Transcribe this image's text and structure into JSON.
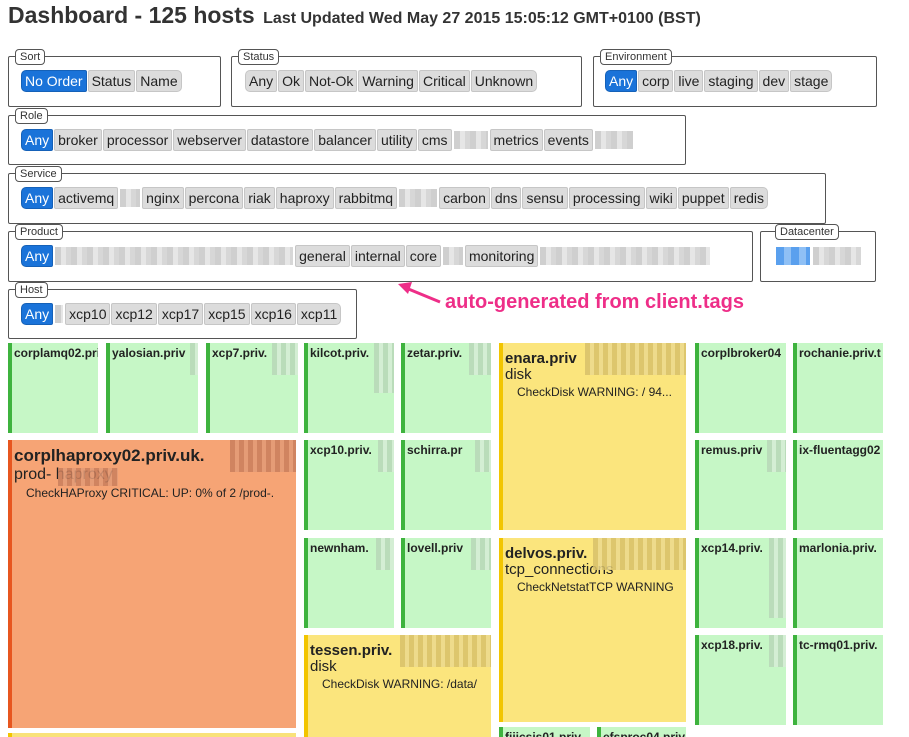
{
  "header": {
    "title": "Dashboard - 125 hosts",
    "updated": "Last Updated Wed May 27 2015 15:05:12 GMT+0100 (BST)"
  },
  "filters": {
    "sort": {
      "legend": "Sort",
      "options": [
        "No Order",
        "Status",
        "Name"
      ]
    },
    "status": {
      "legend": "Status",
      "options": [
        "Any",
        "Ok",
        "Not-Ok",
        "Warning",
        "Critical",
        "Unknown"
      ]
    },
    "environment": {
      "legend": "Environment",
      "options": [
        "Any",
        "corp",
        "live",
        "staging",
        "dev",
        "stage"
      ]
    },
    "role": {
      "legend": "Role",
      "options": [
        "Any",
        "broker",
        "processor",
        "webserver",
        "datastore",
        "balancer",
        "utility",
        "cms",
        "metrics",
        "events"
      ]
    },
    "service": {
      "legend": "Service",
      "options": [
        "Any",
        "activemq",
        "nginx",
        "percona",
        "riak",
        "haproxy",
        "rabbitmq",
        "carbon",
        "dns",
        "sensu",
        "processing",
        "wiki",
        "puppet",
        "redis"
      ]
    },
    "product": {
      "legend": "Product",
      "options": [
        "Any",
        "general",
        "internal",
        "core",
        "monitoring"
      ]
    },
    "datacenter": {
      "legend": "Datacenter"
    },
    "host": {
      "legend": "Host",
      "options": [
        "Any",
        "xcp10",
        "xcp12",
        "xcp17",
        "xcp15",
        "xcp16",
        "xcp11"
      ]
    }
  },
  "annotation": "auto-generated from client.tags",
  "tiles": [
    {
      "name": "corplamq02.pri"
    },
    {
      "name": "yalosian.priv"
    },
    {
      "name": "xcp7.priv."
    },
    {
      "name": "kilcot.priv."
    },
    {
      "name": "zetar.priv."
    },
    {
      "name": "enara.priv",
      "check": "disk",
      "message": "CheckDisk WARNING: / 94..."
    },
    {
      "name": "corplbroker04"
    },
    {
      "name": "rochanie.priv.t"
    },
    {
      "name": "corplhaproxy02.priv.uk.",
      "check": "prod-      haproxy",
      "message": "CheckHAProxy CRITICAL: UP: 0% of 2 /prod-."
    },
    {
      "name": "xcp10.priv."
    },
    {
      "name": "schirra.pr"
    },
    {
      "name": "remus.priv"
    },
    {
      "name": "ix-fluentagg02"
    },
    {
      "name": "newnham."
    },
    {
      "name": "lovell.priv"
    },
    {
      "name": "delvos.priv.",
      "check": "tcp_connections",
      "message": "CheckNetstatTCP WARNING"
    },
    {
      "name": "xcp14.priv."
    },
    {
      "name": "marlonia.priv."
    },
    {
      "name": "tessen.priv.",
      "check": "disk",
      "message": "CheckDisk WARNING: /data/"
    },
    {
      "name": "xcp18.priv."
    },
    {
      "name": "tc-rmq01.priv."
    },
    {
      "name": "fiijcsis01.priv."
    },
    {
      "name": "efsproc04.priv."
    }
  ]
}
